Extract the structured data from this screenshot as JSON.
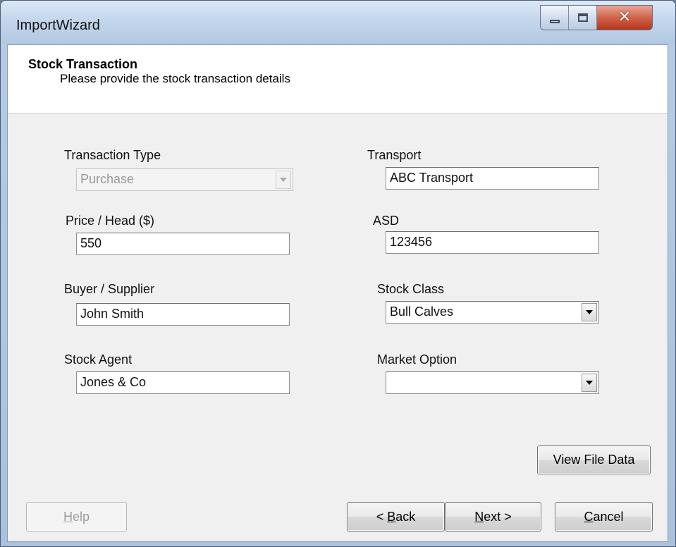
{
  "window": {
    "title": "ImportWizard"
  },
  "header": {
    "title": "Stock Transaction",
    "subtitle": "Please provide the stock transaction details"
  },
  "form": {
    "transaction_type": {
      "label": "Transaction Type",
      "value": "Purchase",
      "disabled": true
    },
    "transport": {
      "label": "Transport",
      "value": "ABC Transport"
    },
    "price_head": {
      "label": "Price / Head ($)",
      "value": "550"
    },
    "asd": {
      "label": "ASD",
      "value": "123456"
    },
    "buyer_supplier": {
      "label": "Buyer / Supplier",
      "value": "John Smith"
    },
    "stock_class": {
      "label": "Stock Class",
      "value": "Bull Calves"
    },
    "stock_agent": {
      "label": "Stock Agent",
      "value": "Jones & Co"
    },
    "market_option": {
      "label": "Market Option",
      "value": ""
    }
  },
  "buttons": {
    "view_file_data": "View File Data",
    "help_pre": "",
    "help_key": "H",
    "help_post": "elp",
    "back_pre": "< ",
    "back_key": "B",
    "back_post": "ack",
    "next_pre": "",
    "next_key": "N",
    "next_post": "ext >",
    "cancel_pre": "",
    "cancel_key": "C",
    "cancel_post": "ancel"
  },
  "icons": {
    "minimize": "minimize-icon",
    "maximize": "maximize-icon",
    "close": "close-icon",
    "dropdown": "chevron-down-icon"
  }
}
